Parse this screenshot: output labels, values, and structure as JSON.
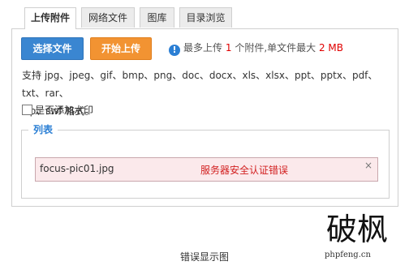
{
  "tabs": [
    {
      "label": "上传附件",
      "active": true
    },
    {
      "label": "网络文件",
      "active": false
    },
    {
      "label": "图库",
      "active": false
    },
    {
      "label": "目录浏览",
      "active": false
    }
  ],
  "buttons": {
    "select": "选择文件",
    "start": "开始上传"
  },
  "info": {
    "icon": "info-icon",
    "prefix": "最多上传",
    "max_count": "1",
    "middle": "个附件,单文件最大",
    "max_size": "2 MB"
  },
  "formats": {
    "line1": "支持 jpg、jpeg、gif、bmp、png、doc、docx、xls、xlsx、ppt、pptx、pdf、txt、rar、",
    "line2": "zip、swf 格式。"
  },
  "watermark": {
    "label": "是否添加水印",
    "checked": false
  },
  "list": {
    "legend": "列表",
    "items": [
      {
        "file_name": "focus-pic01.jpg",
        "error": "服务器安全认证错误",
        "close": "×"
      }
    ]
  },
  "caption": "错误显示图",
  "site": {
    "logo_text": "破枫",
    "url": "phpfeng.cn"
  },
  "colors": {
    "select_button": "#3a86d1",
    "start_button": "#f29332",
    "accent_red": "#e00000",
    "error_bg": "#fbe9eb",
    "legend_blue": "#2b7fd4"
  }
}
